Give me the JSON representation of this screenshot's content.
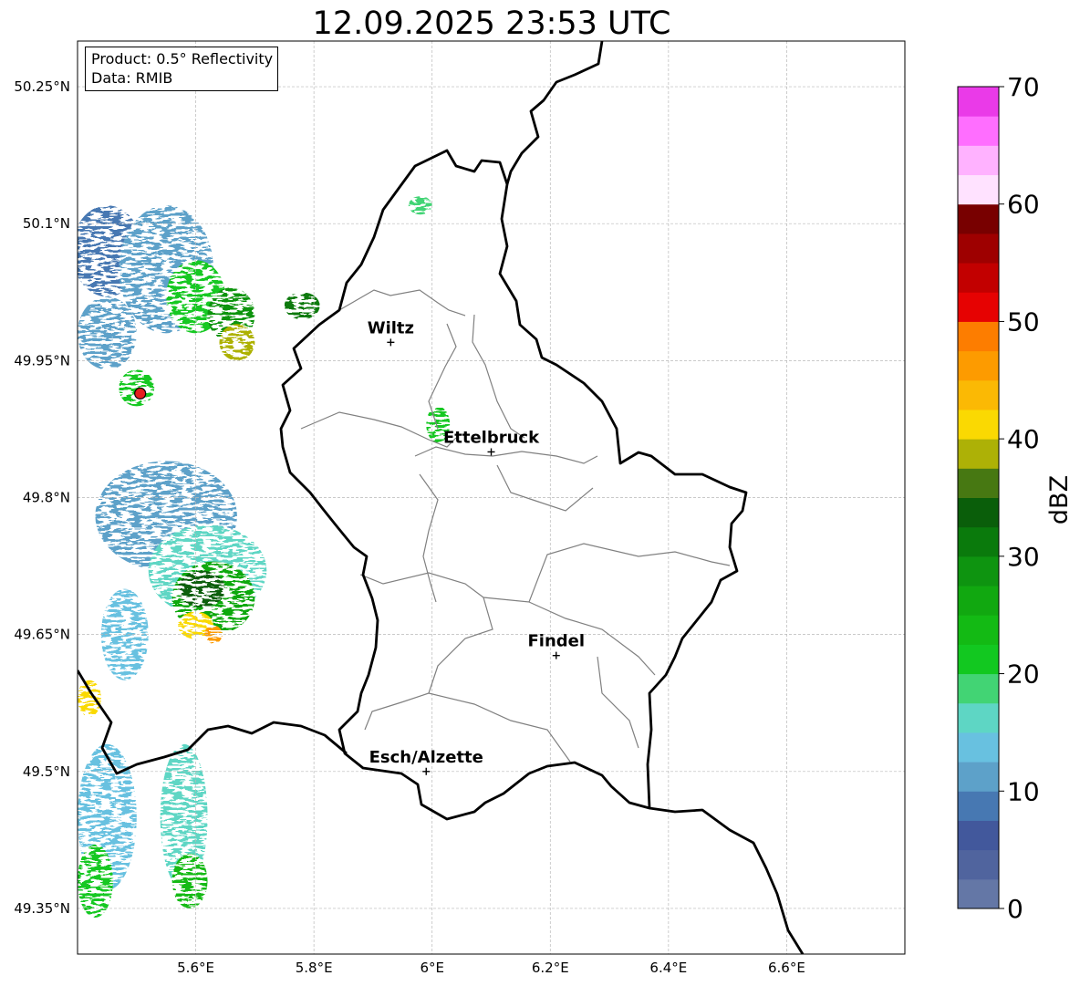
{
  "title": "12.09.2025 23:53 UTC",
  "info": {
    "product": "Product: 0.5° Reflectivity",
    "data_source": "Data: RMIB"
  },
  "map": {
    "lon_range": [
      5.4,
      6.8
    ],
    "lat_range": [
      49.3,
      50.3
    ],
    "lon_ticks": [
      {
        "value": 5.6,
        "label": "5.6°E"
      },
      {
        "value": 5.8,
        "label": "5.8°E"
      },
      {
        "value": 6.0,
        "label": "6°E"
      },
      {
        "value": 6.2,
        "label": "6.2°E"
      },
      {
        "value": 6.4,
        "label": "6.4°E"
      },
      {
        "value": 6.6,
        "label": "6.6°E"
      }
    ],
    "lat_ticks": [
      {
        "value": 49.35,
        "label": "49.35°N"
      },
      {
        "value": 49.5,
        "label": "49.5°N"
      },
      {
        "value": 49.65,
        "label": "49.65°N"
      },
      {
        "value": 49.8,
        "label": "49.8°N"
      },
      {
        "value": 49.95,
        "label": "49.95°N"
      },
      {
        "value": 50.1,
        "label": "50.1°N"
      },
      {
        "value": 50.25,
        "label": "50.25°N"
      }
    ],
    "cities": [
      {
        "name": "Wiltz",
        "lon": 5.93,
        "lat": 49.97
      },
      {
        "name": "Ettelbruck",
        "lon": 6.1,
        "lat": 49.85
      },
      {
        "name": "Findel",
        "lon": 6.21,
        "lat": 49.627
      },
      {
        "name": "Esch/Alzette",
        "lon": 5.99,
        "lat": 49.5
      }
    ],
    "radar_site": {
      "lon": 5.506,
      "lat": 49.914
    },
    "border_color": "#000000",
    "canton_color": "#808080"
  },
  "colorbar": {
    "label": "dBZ",
    "min": 0,
    "max": 70,
    "ticks": [
      0,
      10,
      20,
      30,
      40,
      50,
      60,
      70
    ],
    "step": 2.5,
    "colors": [
      "#6477a6",
      "#50649e",
      "#42589c",
      "#4778b2",
      "#5da1c9",
      "#68c1e0",
      "#5ed6c4",
      "#42d474",
      "#12c820",
      "#13ba14",
      "#11a810",
      "#0e9410",
      "#0a7a0c",
      "#0a5e0a",
      "#477812",
      "#adb106",
      "#fad902",
      "#fbb904",
      "#fd9b00",
      "#fd7d00",
      "#e60202",
      "#c20000",
      "#9e0000",
      "#780000",
      "#ffe2ff",
      "#ffb2ff",
      "#ff6eff",
      "#ea3ae8"
    ]
  },
  "echoes": [
    {
      "lon": 5.45,
      "lat": 50.07,
      "rlon": 0.06,
      "rlat": 0.05,
      "dbz": 8
    },
    {
      "lon": 5.55,
      "lat": 50.05,
      "rlon": 0.08,
      "rlat": 0.07,
      "dbz": 12
    },
    {
      "lon": 5.6,
      "lat": 50.02,
      "rlon": 0.05,
      "rlat": 0.04,
      "dbz": 20
    },
    {
      "lon": 5.66,
      "lat": 50.0,
      "rlon": 0.04,
      "rlat": 0.03,
      "dbz": 28
    },
    {
      "lon": 5.67,
      "lat": 49.97,
      "rlon": 0.03,
      "rlat": 0.02,
      "dbz": 38
    },
    {
      "lon": 5.45,
      "lat": 49.98,
      "rlon": 0.05,
      "rlat": 0.04,
      "dbz": 10
    },
    {
      "lon": 5.5,
      "lat": 49.92,
      "rlon": 0.03,
      "rlat": 0.02,
      "dbz": 22
    },
    {
      "lon": 5.55,
      "lat": 49.78,
      "rlon": 0.12,
      "rlat": 0.06,
      "dbz": 12
    },
    {
      "lon": 5.62,
      "lat": 49.72,
      "rlon": 0.1,
      "rlat": 0.05,
      "dbz": 16
    },
    {
      "lon": 5.63,
      "lat": 49.69,
      "rlon": 0.07,
      "rlat": 0.04,
      "dbz": 26
    },
    {
      "lon": 5.61,
      "lat": 49.7,
      "rlon": 0.04,
      "rlat": 0.02,
      "dbz": 33
    },
    {
      "lon": 5.6,
      "lat": 49.66,
      "rlon": 0.03,
      "rlat": 0.015,
      "dbz": 40
    },
    {
      "lon": 5.63,
      "lat": 49.65,
      "rlon": 0.015,
      "rlat": 0.01,
      "dbz": 46
    },
    {
      "lon": 5.48,
      "lat": 49.65,
      "rlon": 0.04,
      "rlat": 0.05,
      "dbz": 14
    },
    {
      "lon": 5.42,
      "lat": 49.58,
      "rlon": 0.02,
      "rlat": 0.02,
      "dbz": 42
    },
    {
      "lon": 5.45,
      "lat": 49.45,
      "rlon": 0.05,
      "rlat": 0.08,
      "dbz": 14
    },
    {
      "lon": 5.58,
      "lat": 49.45,
      "rlon": 0.04,
      "rlat": 0.08,
      "dbz": 16
    },
    {
      "lon": 5.59,
      "lat": 49.38,
      "rlon": 0.03,
      "rlat": 0.03,
      "dbz": 24
    },
    {
      "lon": 5.43,
      "lat": 49.38,
      "rlon": 0.03,
      "rlat": 0.04,
      "dbz": 22
    },
    {
      "lon": 5.78,
      "lat": 50.01,
      "rlon": 0.03,
      "rlat": 0.015,
      "dbz": 30
    },
    {
      "lon": 6.01,
      "lat": 49.88,
      "rlon": 0.02,
      "rlat": 0.02,
      "dbz": 22
    },
    {
      "lon": 5.98,
      "lat": 50.12,
      "rlon": 0.02,
      "rlat": 0.01,
      "dbz": 18
    }
  ]
}
